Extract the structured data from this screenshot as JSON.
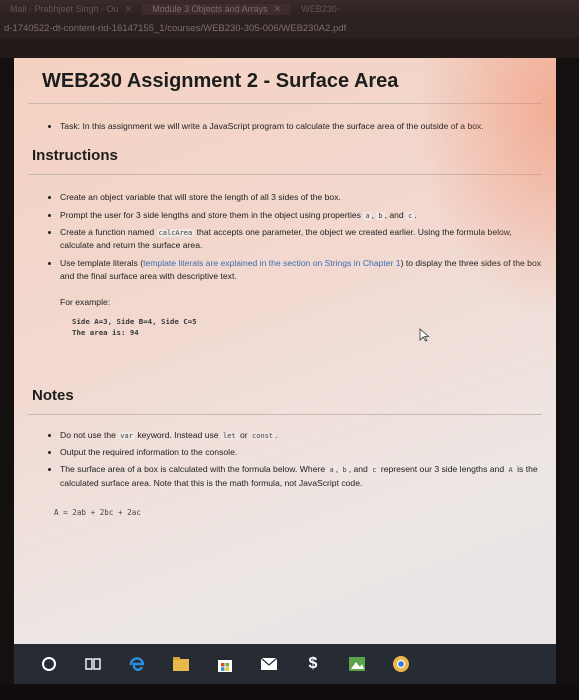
{
  "browser": {
    "tabs": [
      {
        "label": "Mail - Prabhjeet Singh - Ou"
      },
      {
        "label": "Module 3 Objects and Arrays"
      },
      {
        "label": "WEB230-"
      }
    ],
    "url": "d-1740522-dt-content-rid-16147155_1/courses/WEB230-305-006/WEB230A2.pdf"
  },
  "doc": {
    "title": "WEB230 Assignment 2 - Surface Area",
    "task": "Task: In this assignment we will write a JavaScript program to calculate the surface area of the outside of a box.",
    "instructions_heading": "Instructions",
    "instructions": {
      "i1": "Create an object variable that will store the length of all 3 sides of the box.",
      "i2_pre": "Prompt the user for 3 side lengths and store them in the object using properties",
      "i2_a": "a",
      "i2_b": "b",
      "i2_and": ", and",
      "i2_c": "c",
      "i3_pre": "Create a function named",
      "i3_code": "calcArea",
      "i3_post": "that accepts one parameter, the object we created earlier. Using the formula below, calculate and return the surface area.",
      "i4_pre": "Use template literals (",
      "i4_link": "template literals are explained in the section on Strings in Chapter 1",
      "i4_post": ") to display the three sides of the box and the final surface area with descriptive text."
    },
    "example_label": "For example:",
    "example_line1": "Side A=3, Side B=4, Side C=5",
    "example_line2": "The area is: 94",
    "notes_heading": "Notes",
    "notes": {
      "n1_pre": "Do not use the",
      "n1_var": "var",
      "n1_mid": "keyword. Instead use",
      "n1_let": "let",
      "n1_or": "or",
      "n1_const": "const",
      "n2": "Output the required information to the console.",
      "n3_pre": "The surface area of a box is calculated with the formula below. Where",
      "n3_a": "a",
      "n3_b": "b",
      "n3_and": ", and",
      "n3_c": "c",
      "n3_mid": "represent our 3 side lengths and",
      "n3_A": "A",
      "n3_post": "is the calculated surface area. Note that this is the math formula, not JavaScript code."
    },
    "formula": "A = 2ab + 2bc + 2ac"
  },
  "taskbar": {
    "icons": [
      "cortana-icon",
      "task-view-icon",
      "edge-icon",
      "file-explorer-icon",
      "store-icon",
      "mail-icon",
      "dollar-icon",
      "image-app-icon",
      "chrome-icon"
    ]
  }
}
